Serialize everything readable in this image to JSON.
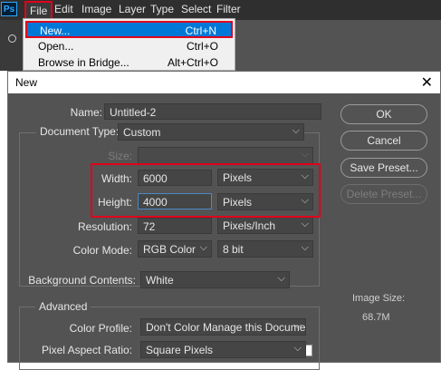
{
  "app": {
    "logo": "Ps",
    "menus": [
      "File",
      "Edit",
      "Image",
      "Layer",
      "Type",
      "Select",
      "Filter"
    ]
  },
  "file_menu": {
    "items": [
      {
        "label": "New...",
        "shortcut": "Ctrl+N"
      },
      {
        "label": "Open...",
        "shortcut": "Ctrl+O"
      },
      {
        "label": "Browse in Bridge...",
        "shortcut": "Alt+Ctrl+O"
      }
    ]
  },
  "dialog": {
    "title": "New",
    "close": "✕",
    "name_label": "Name:",
    "name_value": "Untitled-2",
    "doc_type_label": "Document Type:",
    "doc_type_value": "Custom",
    "size_label": "Size:",
    "size_value": "",
    "width_label": "Width:",
    "width_value": "6000",
    "width_unit": "Pixels",
    "height_label": "Height:",
    "height_value": "4000",
    "height_unit": "Pixels",
    "resolution_label": "Resolution:",
    "resolution_value": "72",
    "resolution_unit": "Pixels/Inch",
    "color_mode_label": "Color Mode:",
    "color_mode_value": "RGB Color",
    "bit_depth": "8 bit",
    "background_label": "Background Contents:",
    "background_value": "White",
    "advanced_label": "Advanced",
    "color_profile_label": "Color Profile:",
    "color_profile_value": "Don't Color Manage this Document",
    "pixel_aspect_label": "Pixel Aspect Ratio:",
    "pixel_aspect_value": "Square Pixels",
    "buttons": {
      "ok": "OK",
      "cancel": "Cancel",
      "save_preset": "Save Preset...",
      "delete_preset": "Delete Preset..."
    },
    "image_size_label": "Image Size:",
    "image_size_value": "68.7M"
  },
  "icons": {
    "chevron": "chevron-down-icon",
    "close": "close-icon"
  },
  "colors": {
    "highlight": "#e0001b",
    "selection": "#0078d7",
    "dialog_bg": "#535353"
  }
}
